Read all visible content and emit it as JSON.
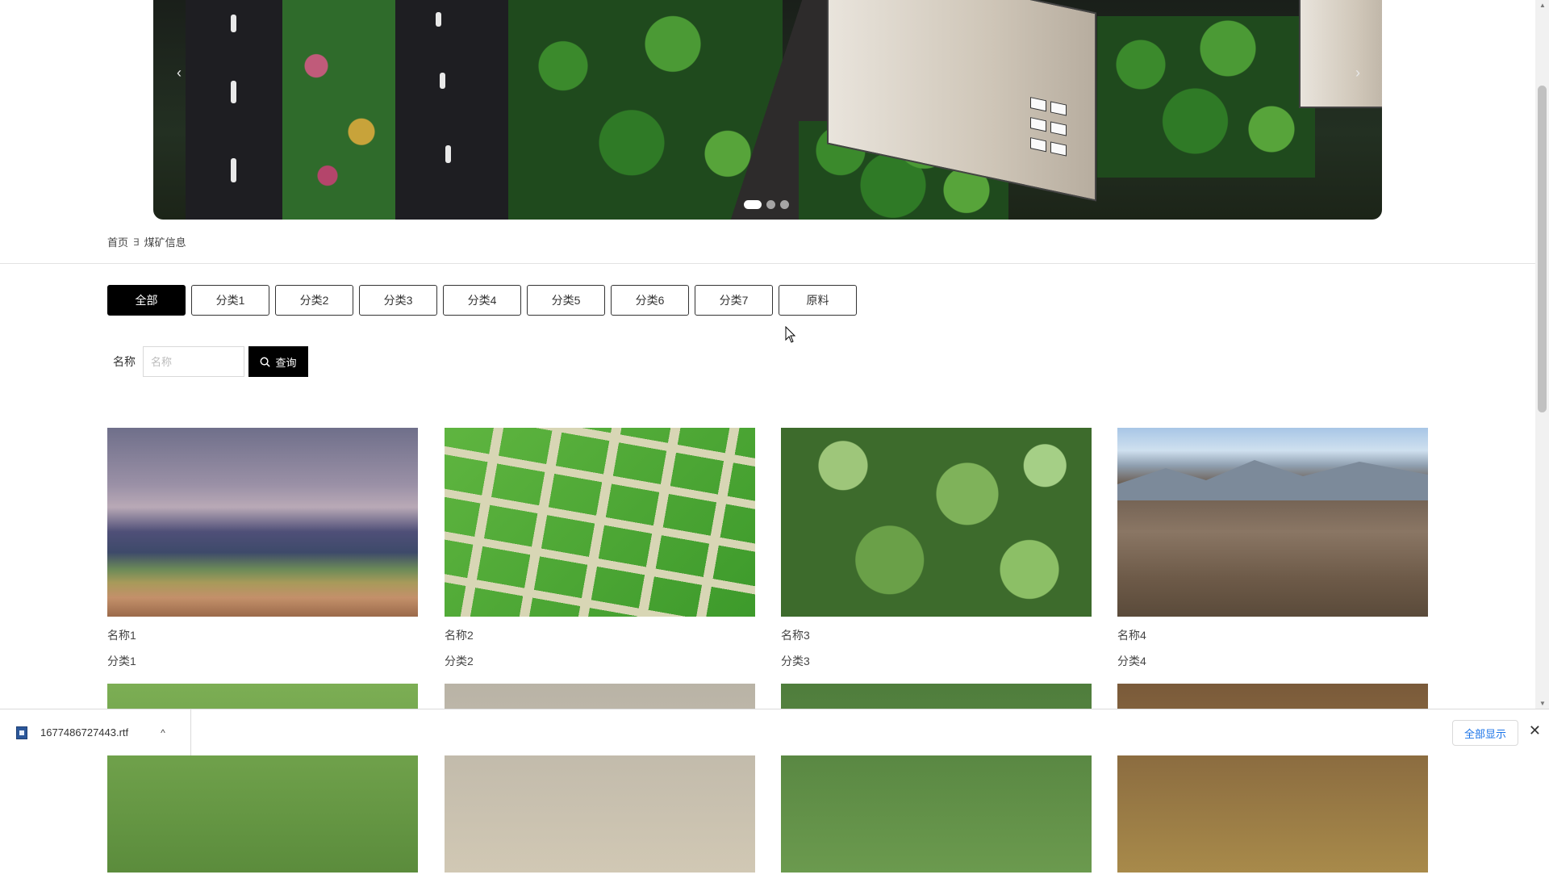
{
  "banner": {
    "prev_arrow": "‹",
    "next_arrow": "›",
    "slide_count": 3,
    "active_slide": 1
  },
  "breadcrumb": {
    "home": "首页",
    "separator": "∃",
    "current": "煤矿信息"
  },
  "categories": [
    {
      "label": "全部",
      "active": true
    },
    {
      "label": "分类1",
      "active": false
    },
    {
      "label": "分类2",
      "active": false
    },
    {
      "label": "分类3",
      "active": false
    },
    {
      "label": "分类4",
      "active": false
    },
    {
      "label": "分类5",
      "active": false
    },
    {
      "label": "分类6",
      "active": false
    },
    {
      "label": "分类7",
      "active": false
    },
    {
      "label": "原料",
      "active": false
    }
  ],
  "search": {
    "label": "名称",
    "placeholder": "名称",
    "value": "",
    "button_label": "查询",
    "button_icon": "search-icon"
  },
  "items": [
    {
      "name": "名称1",
      "category": "分类1",
      "image": "highland-landscape"
    },
    {
      "name": "名称2",
      "category": "分类2",
      "image": "grass-squares"
    },
    {
      "name": "名称3",
      "category": "分类3",
      "image": "leafy-plants"
    },
    {
      "name": "名称4",
      "category": "分类4",
      "image": "dirt-mound"
    },
    {
      "name": "",
      "category": "",
      "image": "green-crop"
    },
    {
      "name": "",
      "category": "",
      "image": "construction-site"
    },
    {
      "name": "",
      "category": "",
      "image": "green-field"
    },
    {
      "name": "",
      "category": "",
      "image": "potatoes"
    }
  ],
  "download_bar": {
    "file_name": "1677486727443.rtf",
    "file_icon": "word-document-icon",
    "show_all_label": "全部显示",
    "close_icon": "✕",
    "chevron": "^"
  },
  "colors": {
    "active_category_bg": "#000000",
    "search_button_bg": "#000000",
    "show_all_text": "#1a73e8"
  }
}
